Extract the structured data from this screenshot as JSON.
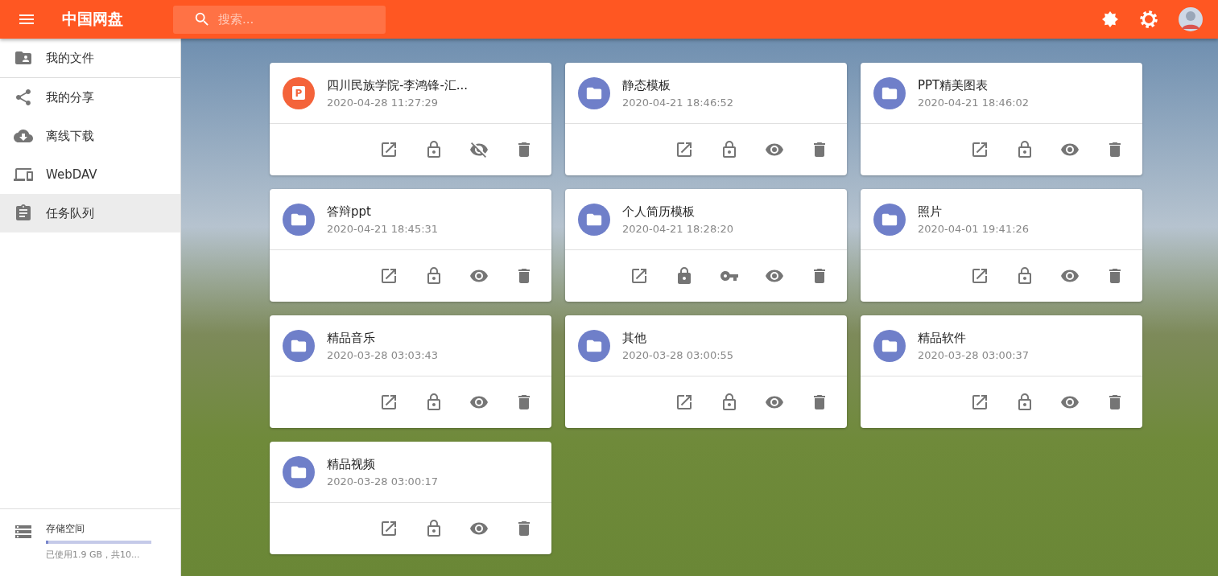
{
  "app_bar": {
    "title": "中国网盘",
    "search": {
      "placeholder": "搜索..."
    }
  },
  "sidebar": {
    "items": [
      {
        "label": "我的文件",
        "selected": false
      },
      {
        "label": "我的分享",
        "selected": false
      },
      {
        "label": "离线下载",
        "selected": false
      },
      {
        "label": "WebDAV",
        "selected": false
      },
      {
        "label": "任务队列",
        "selected": true
      }
    ],
    "storage": {
      "title": "存储空间",
      "level": 0.02,
      "usage": "已使用1.9 GB，共10..."
    }
  },
  "cards": [
    {
      "kind": "ppt",
      "badge": "P",
      "name": "四川民族学院-李鸿锋-汇...",
      "date": "2020-04-28 11:27:29",
      "locked": false,
      "has_password": false,
      "hidden": true
    },
    {
      "kind": "folder",
      "name": "静态模板",
      "date": "2020-04-21 18:46:52",
      "locked": false,
      "has_password": false,
      "hidden": false
    },
    {
      "kind": "folder",
      "name": "PPT精美图表",
      "date": "2020-04-21 18:46:02",
      "locked": false,
      "has_password": false,
      "hidden": false
    },
    {
      "kind": "folder",
      "name": "答辩ppt",
      "date": "2020-04-21 18:45:31",
      "locked": false,
      "has_password": false,
      "hidden": false
    },
    {
      "kind": "folder",
      "name": "个人简历模板",
      "date": "2020-04-21 18:28:20",
      "locked": true,
      "has_password": true,
      "hidden": false
    },
    {
      "kind": "folder",
      "name": "照片",
      "date": "2020-04-01 19:41:26",
      "locked": false,
      "has_password": false,
      "hidden": false
    },
    {
      "kind": "folder",
      "name": "精品音乐",
      "date": "2020-03-28 03:03:43",
      "locked": false,
      "has_password": false,
      "hidden": false
    },
    {
      "kind": "folder",
      "name": "其他",
      "date": "2020-03-28 03:00:55",
      "locked": false,
      "has_password": false,
      "hidden": false
    },
    {
      "kind": "folder",
      "name": "精品软件",
      "date": "2020-03-28 03:00:37",
      "locked": false,
      "has_password": false,
      "hidden": false
    },
    {
      "kind": "folder",
      "name": "精品视频",
      "date": "2020-03-28 03:00:17",
      "locked": false,
      "has_password": false,
      "hidden": false
    }
  ]
}
